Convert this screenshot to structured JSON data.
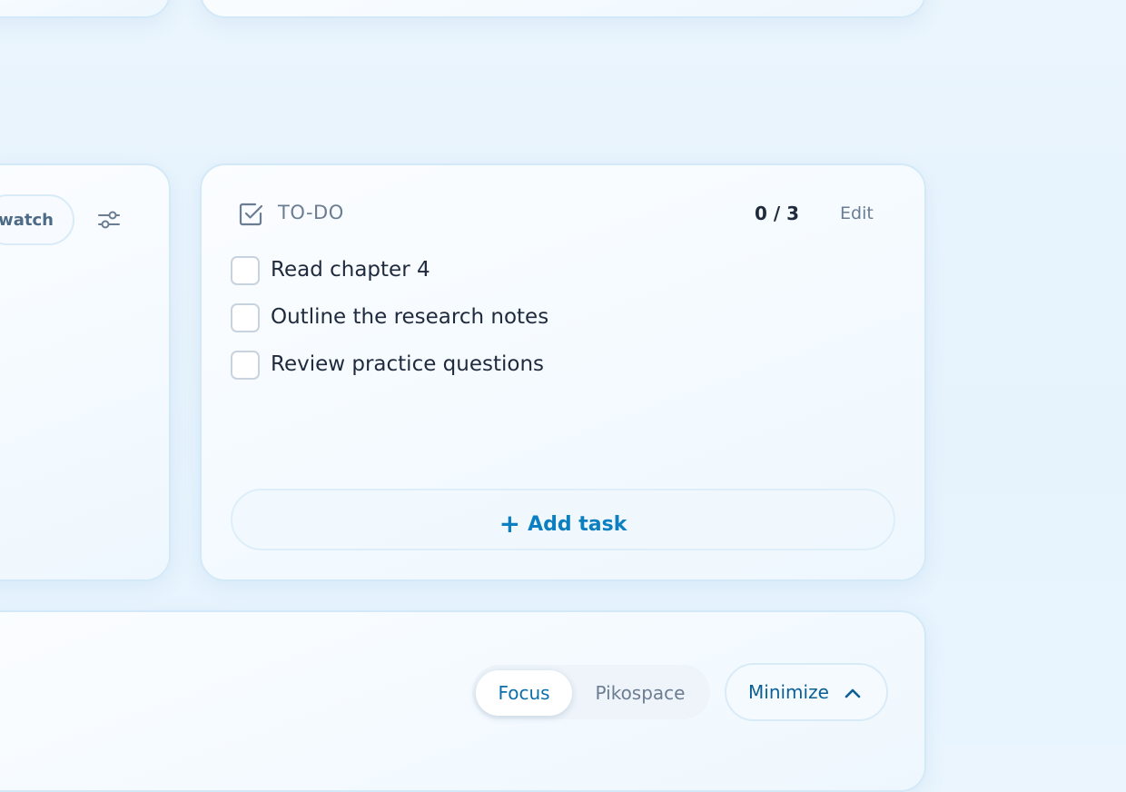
{
  "left_panel": {
    "stopwatch_label": "Stopwatch"
  },
  "todo": {
    "title": "TO-DO",
    "count": "0 / 3",
    "edit_label": "Edit",
    "tasks": [
      {
        "label": "Read chapter 4",
        "done": false
      },
      {
        "label": "Outline the research notes",
        "done": false
      },
      {
        "label": "Review practice questions",
        "done": false
      }
    ],
    "add_task_label": "Add task"
  },
  "bottom_bar": {
    "modes": [
      "Focus",
      "Pikospace"
    ],
    "selected_mode": "Focus",
    "minimize_label": "Minimize"
  },
  "colors": {
    "accent": "#0b7fc0",
    "text_primary": "#1f2a3d",
    "text_muted": "#6b7d92",
    "background": "#e8f4fd"
  },
  "icons": {
    "todo": "checkbox-check-icon",
    "settings": "sliders-icon",
    "add": "plus-icon",
    "minimize": "chevron-up-icon"
  }
}
